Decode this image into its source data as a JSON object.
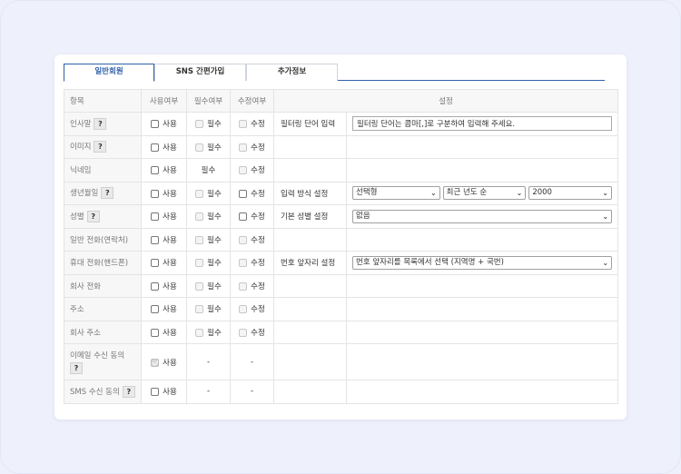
{
  "tabs": [
    {
      "label": "일반회원"
    },
    {
      "label": "SNS 간편가입"
    },
    {
      "label": "추가정보"
    }
  ],
  "header": {
    "item": "항목",
    "use": "사용여부",
    "required": "필수여부",
    "editable": "수정여부",
    "settings": "설정"
  },
  "rows": [
    {
      "label": "인사말",
      "use": "사용",
      "req": "필수",
      "edit": "수정"
    },
    {
      "label": "이미지",
      "use": "사용",
      "req": "필수",
      "edit": "수정"
    },
    {
      "label": "닉네임",
      "use": "사용",
      "req": "필수",
      "edit": "수정"
    },
    {
      "label": "생년월일",
      "use": "사용",
      "req": "필수",
      "edit": "수정"
    },
    {
      "label": "성별",
      "use": "사용",
      "req": "필수",
      "edit": "수정"
    },
    {
      "label": "일반 전화(연락처)",
      "use": "사용",
      "req": "필수",
      "edit": "수정"
    },
    {
      "label": "휴대 전화(핸드폰)",
      "use": "사용",
      "req": "필수",
      "edit": "수정"
    },
    {
      "label": "회사 전화",
      "use": "사용",
      "req": "필수",
      "edit": "수정"
    },
    {
      "label": "주소",
      "use": "사용",
      "req": "필수",
      "edit": "수정"
    },
    {
      "label": "회사 주소",
      "use": "사용",
      "req": "필수",
      "edit": "수정"
    },
    {
      "label": "이메일 수신 동의",
      "use": "사용",
      "req": "-",
      "edit": "-"
    },
    {
      "label": "SMS 수신 동의",
      "use": "사용",
      "req": "-",
      "edit": "-"
    }
  ],
  "help_mark": "?",
  "settings": {
    "filter_label": "필터링 단어 입력",
    "filter_value": "필터링 단어는 콤마[,]로 구분하여 입력해 주세요.",
    "input_method_label": "입력 방식 설정",
    "input_method_value": "선택형",
    "year_order_value": "최근 년도 순",
    "year_value": "2000",
    "gender_label": "기본 성별 설정",
    "gender_value": "없음",
    "phone_prefix_label": "번호 앞자리 설정",
    "phone_prefix_value": "번호 앞자리를 목록에서 선택 (지역명 + 국번)"
  }
}
